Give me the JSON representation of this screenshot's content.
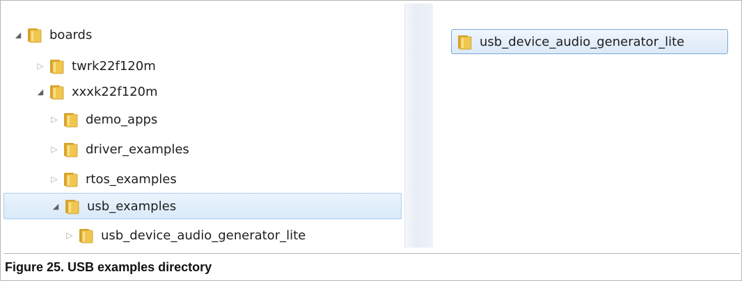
{
  "tree": {
    "nodes": [
      {
        "label": "boards",
        "state": "expanded",
        "depth": 0
      },
      {
        "label": "twrk22f120m",
        "state": "collapsed",
        "depth": 1
      },
      {
        "label": "xxxk22f120m",
        "state": "expanded",
        "depth": 1
      },
      {
        "label": "demo_apps",
        "state": "collapsed",
        "depth": 2
      },
      {
        "label": "driver_examples",
        "state": "collapsed",
        "depth": 2
      },
      {
        "label": "rtos_examples",
        "state": "collapsed",
        "depth": 2
      },
      {
        "label": "usb_examples",
        "state": "expanded",
        "depth": 2,
        "selected": true
      },
      {
        "label": "usb_device_audio_generator_lite",
        "state": "collapsed",
        "depth": 3
      }
    ]
  },
  "content": {
    "items": [
      {
        "label": "usb_device_audio_generator_lite"
      }
    ]
  },
  "caption": {
    "text": "Figure 25.  USB examples directory"
  },
  "icons": {
    "expanded": "triangle-down-right-icon",
    "collapsed": "triangle-right-icon",
    "folder": "folder-icon"
  },
  "colors": {
    "selection_fill": "#d9eaf9",
    "selection_border": "#a8cdf0",
    "folder": "#e8b83a"
  }
}
